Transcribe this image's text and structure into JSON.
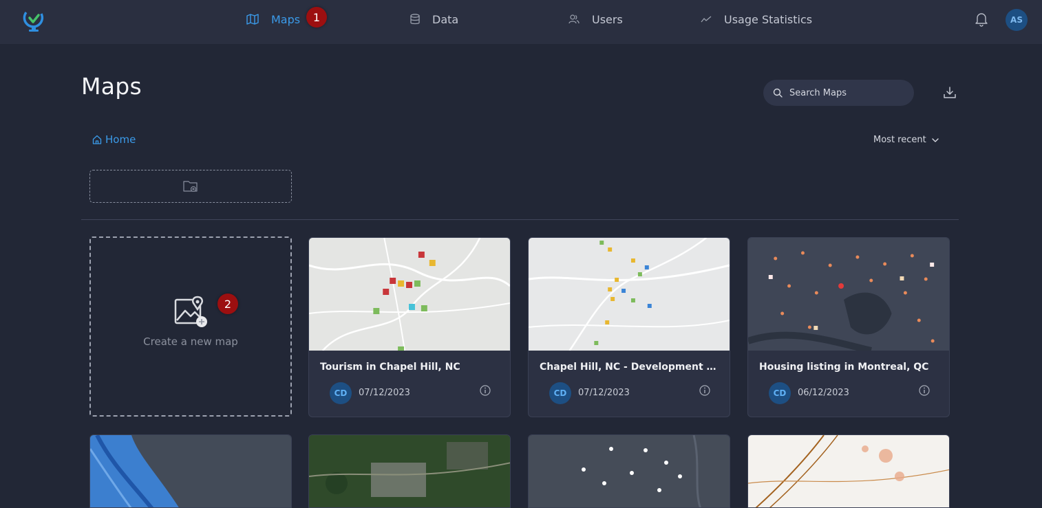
{
  "nav": {
    "items": [
      {
        "label": "Maps",
        "icon": "map-icon",
        "active": true
      },
      {
        "label": "Data",
        "icon": "database-icon",
        "active": false
      },
      {
        "label": "Users",
        "icon": "users-icon",
        "active": false
      },
      {
        "label": "Usage Statistics",
        "icon": "trend-icon",
        "active": false
      }
    ],
    "user_initials": "AS"
  },
  "annotations": {
    "badge1": "1",
    "badge2": "2"
  },
  "page": {
    "title": "Maps",
    "breadcrumb": "Home",
    "sort_label": "Most recent"
  },
  "search": {
    "placeholder": "Search Maps"
  },
  "create_card": {
    "label": "Create a new map"
  },
  "cards": [
    {
      "title": "Tourism in Chapel Hill, NC",
      "initials": "CD",
      "date": "07/12/2023",
      "theme": "light"
    },
    {
      "title": "Chapel Hill, NC - Development Activity",
      "initials": "CD",
      "date": "07/12/2023",
      "theme": "light"
    },
    {
      "title": "Housing listing in Montreal, QC",
      "initials": "CD",
      "date": "06/12/2023",
      "theme": "dark"
    }
  ],
  "colors": {
    "accent": "#3b9bea",
    "badge": "#9c0f10",
    "background": "#222736",
    "topbar": "#2a2f40"
  }
}
